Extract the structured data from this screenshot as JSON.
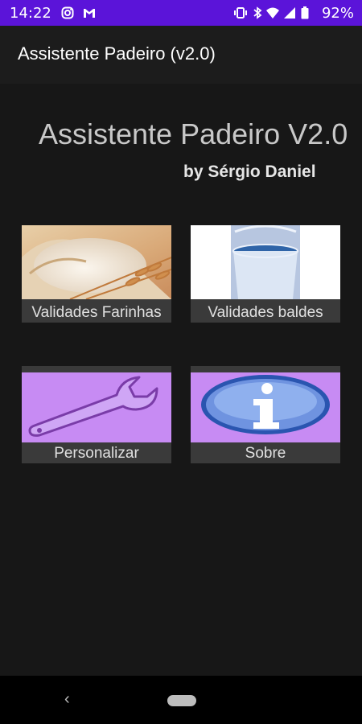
{
  "status": {
    "time": "14:22",
    "battery": "92%",
    "icons": [
      "instagram-icon",
      "gmail-icon",
      "vibrate-icon",
      "bluetooth-icon",
      "wifi-icon",
      "signal-icon",
      "battery-icon"
    ]
  },
  "appbar": {
    "title": "Assistente Padeiro (v2.0)"
  },
  "main": {
    "heading": "Assistente Padeiro V2.0",
    "byline": "by Sérgio Daniel"
  },
  "tiles": [
    {
      "label": "Validades Farinhas",
      "icon": "flour-image"
    },
    {
      "label": "Validades baldes",
      "icon": "bucket-image"
    },
    {
      "label": "Personalizar",
      "icon": "wrench-icon"
    },
    {
      "label": "Sobre",
      "icon": "info-icon"
    }
  ],
  "nav": {
    "back": "‹"
  },
  "colors": {
    "statusbar": "#5b14d9",
    "tile_purple": "#c78bf3",
    "background": "#171717"
  }
}
